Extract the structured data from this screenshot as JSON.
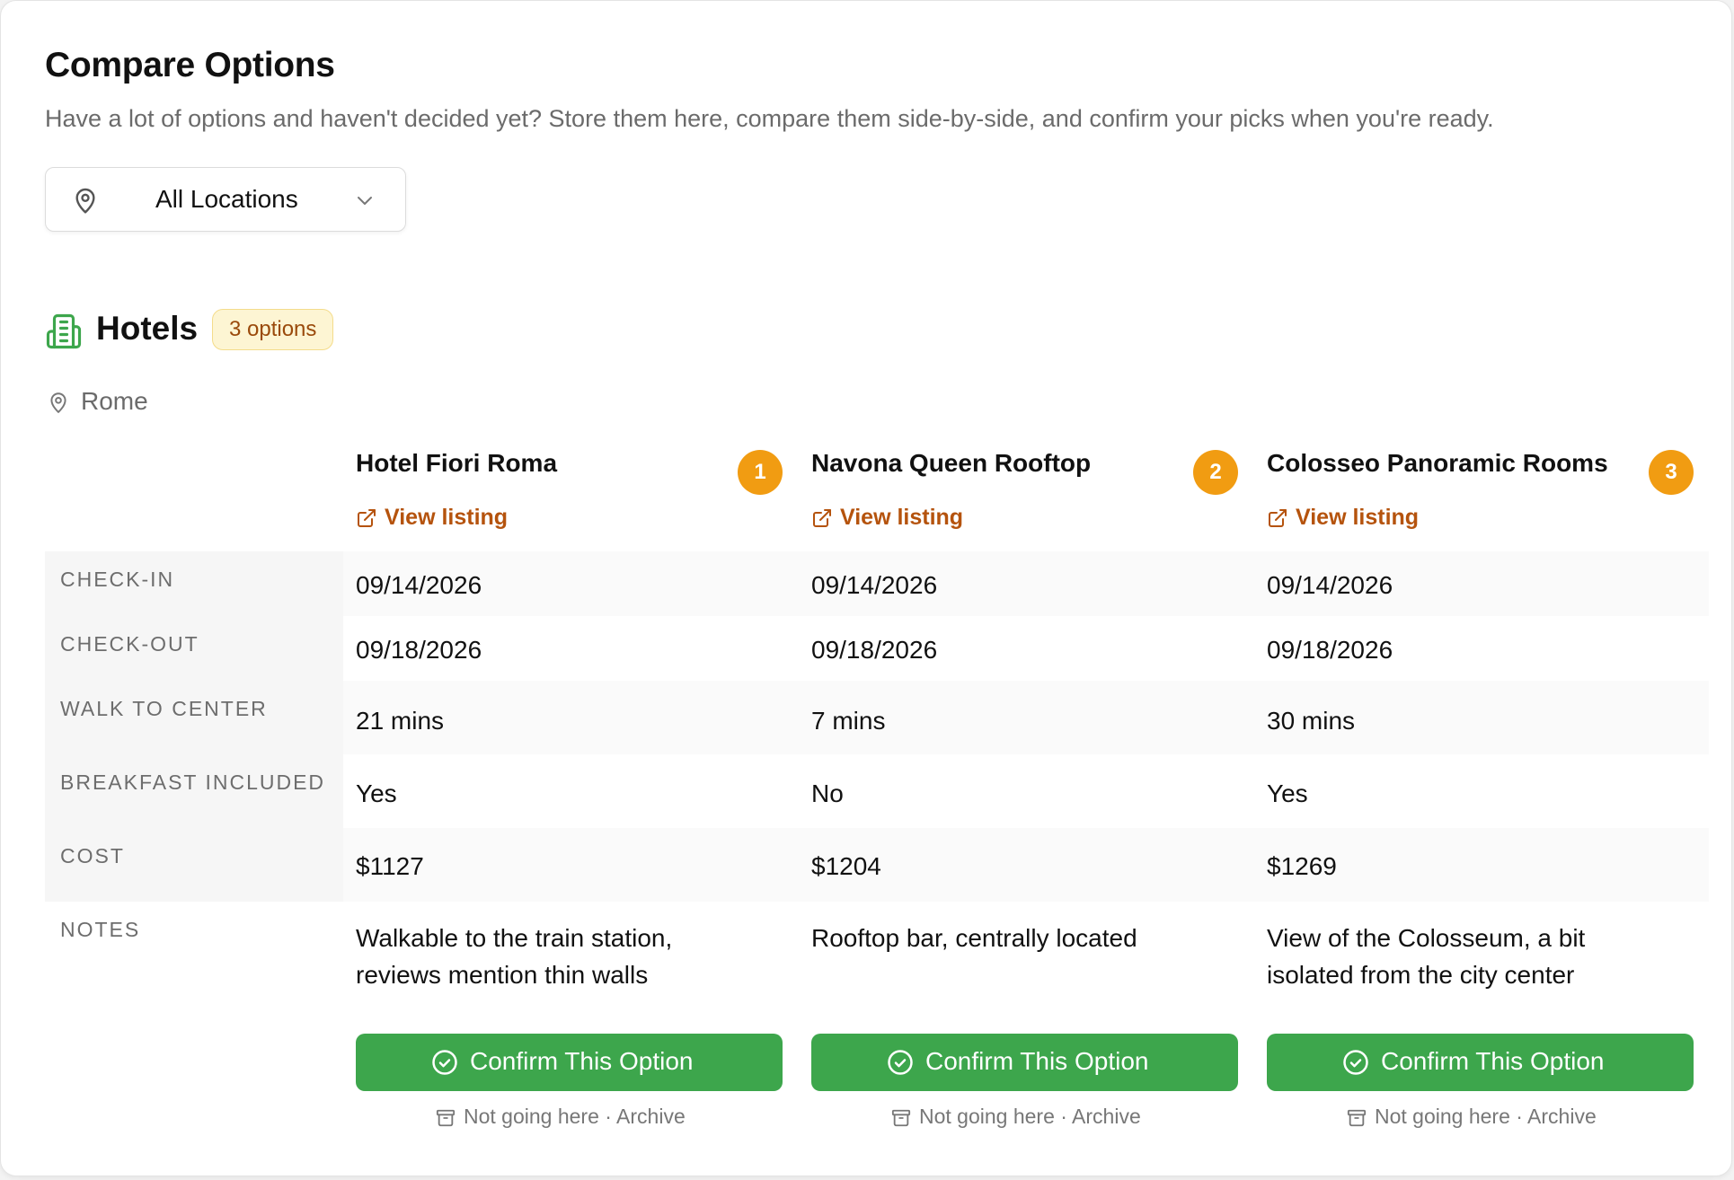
{
  "header": {
    "title": "Compare Options",
    "subtitle": "Have a lot of options and haven't decided yet? Store them here, compare them side-by-side, and confirm your picks when you're ready."
  },
  "location_filter": {
    "selected": "All Locations",
    "icon": "map-pin-icon"
  },
  "section": {
    "title": "Hotels",
    "badge": "3 options",
    "icon": "hotel-building-icon",
    "city": "Rome",
    "accent": "#3da64c"
  },
  "row_labels": {
    "check_in": "CHECK-IN",
    "check_out": "CHECK-OUT",
    "walk": "WALK TO CENTER",
    "breakfast": "BREAKFAST INCLUDED",
    "cost": "COST",
    "notes": "NOTES"
  },
  "options": [
    {
      "name": "Hotel Fiori Roma",
      "number": "1",
      "link": "View listing",
      "check_in": "09/14/2026",
      "check_out": "09/18/2026",
      "walk": "21 mins",
      "breakfast": "Yes",
      "cost": "$1127",
      "notes": "Walkable to the train station, reviews mention thin walls",
      "confirm": "Confirm This Option",
      "archive": "Not going here · Archive"
    },
    {
      "name": "Navona Queen Rooftop",
      "number": "2",
      "link": "View listing",
      "check_in": "09/14/2026",
      "check_out": "09/18/2026",
      "walk": "7 mins",
      "breakfast": "No",
      "cost": "$1204",
      "notes": "Rooftop bar, centrally located",
      "confirm": "Confirm This Option",
      "archive": "Not going here · Archive"
    },
    {
      "name": "Colosseo Panoramic Rooms",
      "number": "3",
      "link": "View listing",
      "check_in": "09/14/2026",
      "check_out": "09/18/2026",
      "walk": "30 mins",
      "breakfast": "Yes",
      "cost": "$1269",
      "notes": "View of the Colosseum, a bit isolated from the city center",
      "confirm": "Confirm This Option",
      "archive": "Not going here · Archive"
    }
  ],
  "colors": {
    "badge_bg": "#fdf5d3",
    "link": "#b5530d",
    "number_badge": "#f19c12",
    "confirm": "#3da64c"
  }
}
